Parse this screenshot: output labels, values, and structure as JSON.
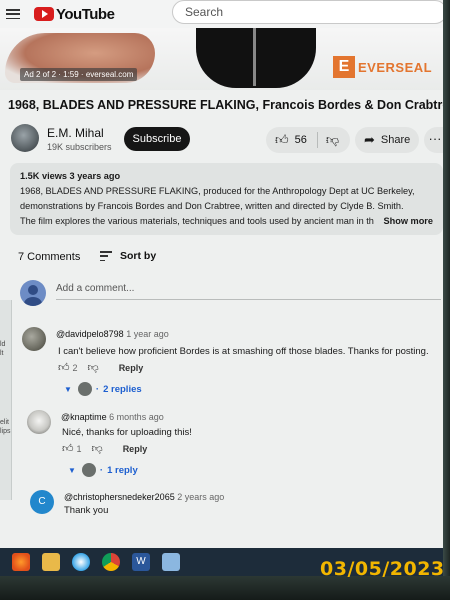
{
  "header": {
    "logo_text": "YouTube",
    "search_placeholder": "Search"
  },
  "ad": {
    "label": "Ad 2 of 2 · 1:59 · everseal.com",
    "brand": "EVERSEAL",
    "brand_mark": "E"
  },
  "video": {
    "title": "1968, BLADES AND PRESSURE FLAKING, Francois Bordes & Don Crabtree",
    "channel_name": "E.M. Mihal",
    "subscribers": "19K subscribers",
    "subscribe_label": "Subscribe",
    "likes": "56",
    "share_label": "Share",
    "more_label": "···"
  },
  "description": {
    "meta": "1.5K views  3 years ago",
    "line1": "1968, BLADES AND PRESSURE FLAKING, produced for the Anthropology Dept at UC Berkeley,",
    "line2": "demonstrations by Francois Bordes and  Don Crabtree, written and directed by Clyde B. Smith.",
    "line3": "The film explores the various materials, techniques and tools used by ancient man in th",
    "show_more": "Show more"
  },
  "comments_section": {
    "count_label": "7 Comments",
    "sort_label": "Sort by",
    "add_placeholder": "Add a comment..."
  },
  "comments": [
    {
      "author": "@davidpelo8798",
      "time": "1 year ago",
      "text": "I can't believe how proficient Bordes is at smashing off those blades. Thanks for posting.",
      "likes": "2",
      "reply_label": "Reply",
      "replies_label": "2 replies"
    },
    {
      "author": "@knaptime",
      "time": "6 months ago",
      "text": "Nicé, thanks for uploading this!",
      "likes": "1",
      "reply_label": "Reply",
      "replies_label": "1 reply"
    },
    {
      "author": "@christophersnedeker2065",
      "time": "2 years ago",
      "text": "Thank you",
      "avatar_letter": "C"
    }
  ],
  "left_window": {
    "text1": "ld",
    "text2": "lt",
    "text3": "elit",
    "text4": "lips"
  },
  "taskbar": {
    "word_icon": "W"
  },
  "photo_stamp": {
    "date": "03/05/2023"
  },
  "colors": {
    "accent_red": "#e01b1b",
    "link_blue": "#1a5fd6",
    "ad_orange": "#e8742a",
    "stamp_yellow": "#f2b600"
  }
}
